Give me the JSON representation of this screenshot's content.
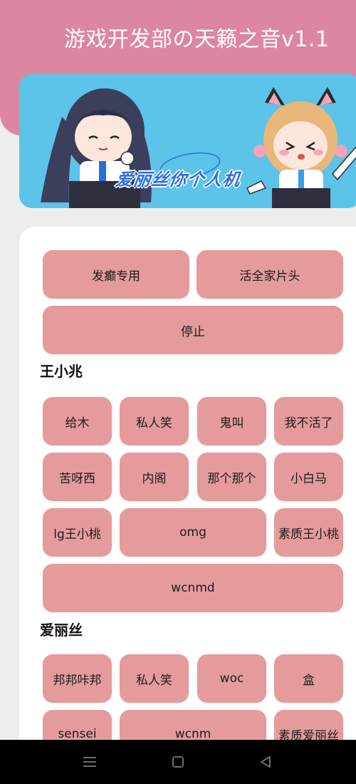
{
  "header": {
    "title": "游戏开发部の天籁之音v1.1"
  },
  "banner": {
    "caption": "爱丽丝你个人机"
  },
  "controls": {
    "crazy_label": "发癫专用",
    "intro_label": "活全家片头",
    "stop_label": "停止"
  },
  "sections": [
    {
      "title": "王小兆",
      "buttons": [
        "给木",
        "私人笑",
        "鬼叫",
        "我不活了",
        "苦呀西",
        "内阁",
        "那个那个",
        "小白马",
        "lg王小桃",
        "omg",
        "素质王小桃",
        "wcnmd"
      ]
    },
    {
      "title": "爱丽丝",
      "buttons": [
        "邦邦咔邦",
        "私人笑",
        "woc",
        "盒",
        "sensei",
        "wcnm",
        "素质爱丽丝"
      ]
    }
  ],
  "navbar": {
    "icons": [
      "menu-icon",
      "home-square-icon",
      "back-triangle-icon"
    ]
  },
  "colors": {
    "header": "#dd86a0",
    "button": "#e59b9b",
    "banner": "#5cc3e9",
    "background": "#ededed"
  }
}
